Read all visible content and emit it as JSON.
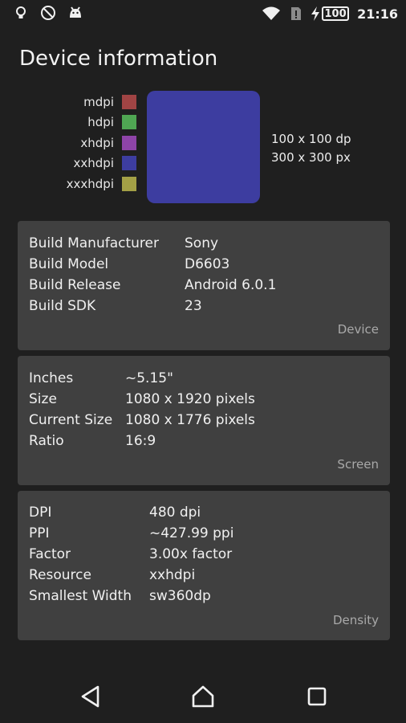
{
  "status_bar": {
    "left_icons": [
      "lightbulb-icon",
      "no-location-icon",
      "android-icon"
    ],
    "right_icons": [
      "wifi-icon",
      "no-sim-icon",
      "charging-icon"
    ],
    "battery": "100",
    "time": "21:16"
  },
  "title": "Device information",
  "densities": [
    {
      "label": "mdpi",
      "color": "#a04444"
    },
    {
      "label": "hdpi",
      "color": "#4fa653"
    },
    {
      "label": "xhdpi",
      "color": "#8e44a8"
    },
    {
      "label": "xxhdpi",
      "color": "#3d3da0"
    },
    {
      "label": "xxxhdpi",
      "color": "#a3a046"
    }
  ],
  "sample": {
    "color": "#3d3da0",
    "dp": "100 x 100 dp",
    "px": "300 x 300 px"
  },
  "device_card": {
    "rows": [
      {
        "key": "Build Manufacturer",
        "value": "Sony"
      },
      {
        "key": "Build Model",
        "value": "D6603"
      },
      {
        "key": "Build Release",
        "value": "Android 6.0.1"
      },
      {
        "key": "Build SDK",
        "value": "23"
      }
    ],
    "tag": "Device"
  },
  "screen_card": {
    "rows": [
      {
        "key": "Inches",
        "value": "~5.15\""
      },
      {
        "key": "Size",
        "value": "1080 x 1920 pixels"
      },
      {
        "key": "Current Size",
        "value": "1080 x 1776 pixels"
      },
      {
        "key": "Ratio",
        "value": "16:9"
      }
    ],
    "tag": "Screen"
  },
  "density_card": {
    "rows": [
      {
        "key": "DPI",
        "value": "480 dpi"
      },
      {
        "key": "PPI",
        "value": "~427.99 ppi"
      },
      {
        "key": "Factor",
        "value": "3.00x factor"
      },
      {
        "key": "Resource",
        "value": "xxhdpi"
      },
      {
        "key": "Smallest Width",
        "value": "sw360dp"
      }
    ],
    "tag": "Density"
  },
  "nav": {
    "icons": [
      "back-icon",
      "home-icon",
      "recents-icon"
    ]
  }
}
